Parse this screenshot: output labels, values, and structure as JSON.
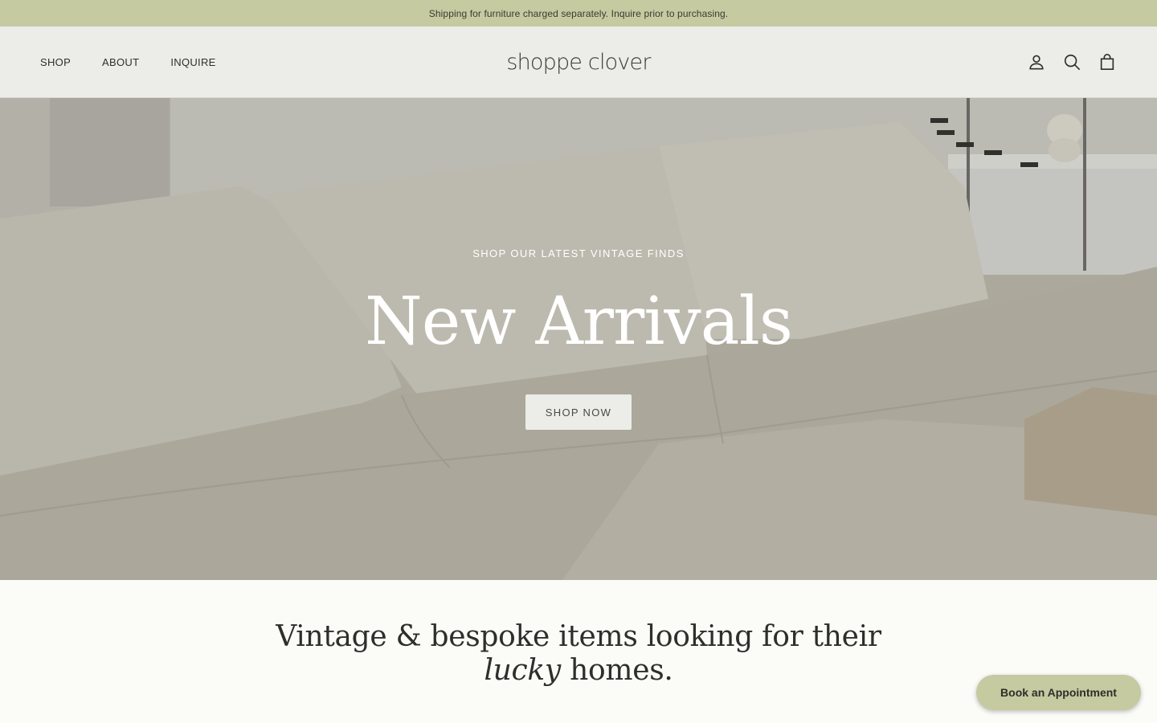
{
  "announcement": {
    "text": "Shipping for furniture charged separately. Inquire prior to purchasing."
  },
  "header": {
    "nav": [
      {
        "label": "SHOP"
      },
      {
        "label": "ABOUT"
      },
      {
        "label": "INQUIRE"
      }
    ],
    "logo_text": "shoppe clover",
    "icons": [
      "account-icon",
      "search-icon",
      "cart-icon"
    ]
  },
  "hero": {
    "subtitle": "SHOP OUR LATEST VINTAGE FINDS",
    "title": "New Arrivals",
    "button_label": "SHOP NOW"
  },
  "intro": {
    "line1": "Vintage & bespoke items looking for their",
    "line2_italic": "lucky",
    "line2_rest": " homes."
  },
  "floating_button": {
    "label": "Book an Appointment"
  },
  "colors": {
    "announcement_bg": "#c5caa0",
    "header_bg": "#ecede9",
    "accent": "#c5caa0",
    "text": "#2e2e2a"
  }
}
